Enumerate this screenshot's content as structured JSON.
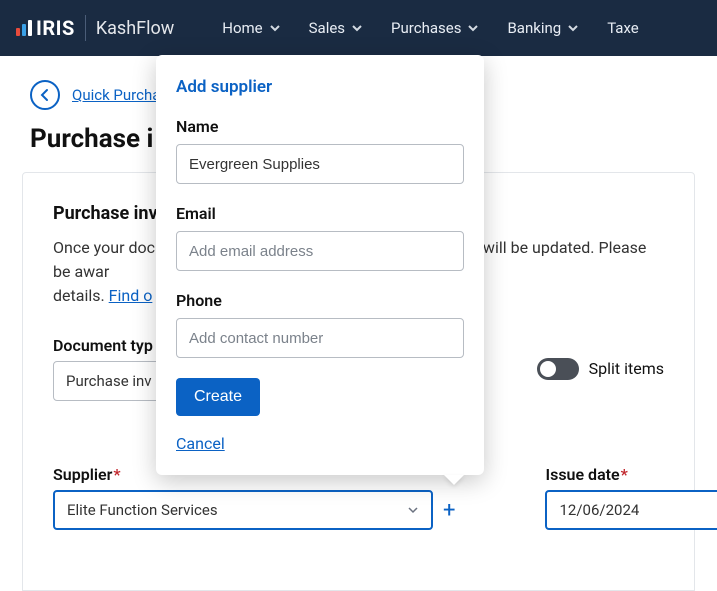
{
  "nav": {
    "brand": "IRIS",
    "product": "KashFlow",
    "items": [
      "Home",
      "Sales",
      "Purchases",
      "Banking",
      "Taxe"
    ]
  },
  "subhead": {
    "quick_link": "Quick Purcha",
    "page_title": "Purchase i"
  },
  "panel": {
    "section_title": "Purchase invo",
    "desc_pre": "Once your doc",
    "desc_mid": "will be updated. Please be awar",
    "desc_post": "details.",
    "find_link": "Find o",
    "doc_type_label": "Document typ",
    "doc_type_value": "Purchase inv",
    "split_label": "Split items",
    "supplier_label": "Supplier",
    "supplier_value": "Elite Function Services",
    "issue_date_label": "Issue date",
    "issue_date_value": "12/06/2024"
  },
  "popover": {
    "title": "Add supplier",
    "name_label": "Name",
    "name_value": "Evergreen Supplies",
    "email_label": "Email",
    "email_placeholder": "Add email address",
    "phone_label": "Phone",
    "phone_placeholder": "Add contact number",
    "create_label": "Create",
    "cancel_label": "Cancel"
  }
}
